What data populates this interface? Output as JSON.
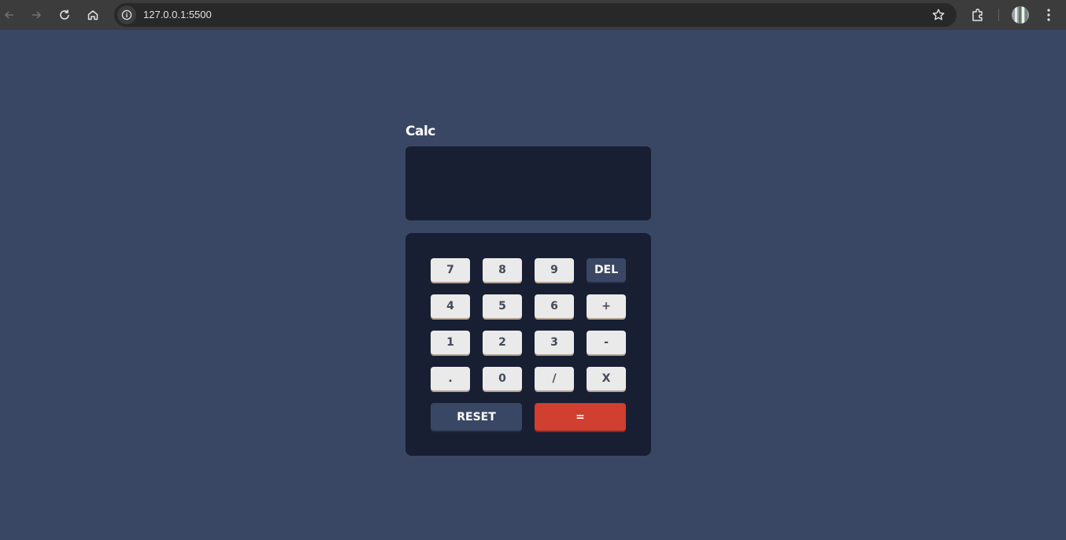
{
  "browser": {
    "url": "127.0.0.1:5500",
    "icons": {
      "back": "arrow-left-icon",
      "forward": "arrow-right-icon",
      "reload": "reload-icon",
      "home": "home-icon",
      "site_info": "info-icon",
      "bookmark": "star-icon",
      "extensions": "puzzle-icon",
      "profile": "avatar",
      "menu": "more-vert-icon"
    }
  },
  "calculator": {
    "title": "Calc",
    "display_value": "",
    "keys": {
      "k7": "7",
      "k8": "8",
      "k9": "9",
      "del": "DEL",
      "k4": "4",
      "k5": "5",
      "k6": "6",
      "plus": "+",
      "k1": "1",
      "k2": "2",
      "k3": "3",
      "minus": "-",
      "dot": ".",
      "k0": "0",
      "divide": "/",
      "multiply": "X",
      "reset": "RESET",
      "equals": "="
    },
    "colors": {
      "page_bg": "#3a4764",
      "panel_bg": "#181f33",
      "key_bg": "#eaeaea",
      "key_text": "#434a59",
      "accent_key": "#3a4764",
      "equals_key": "#d03f2f"
    }
  }
}
